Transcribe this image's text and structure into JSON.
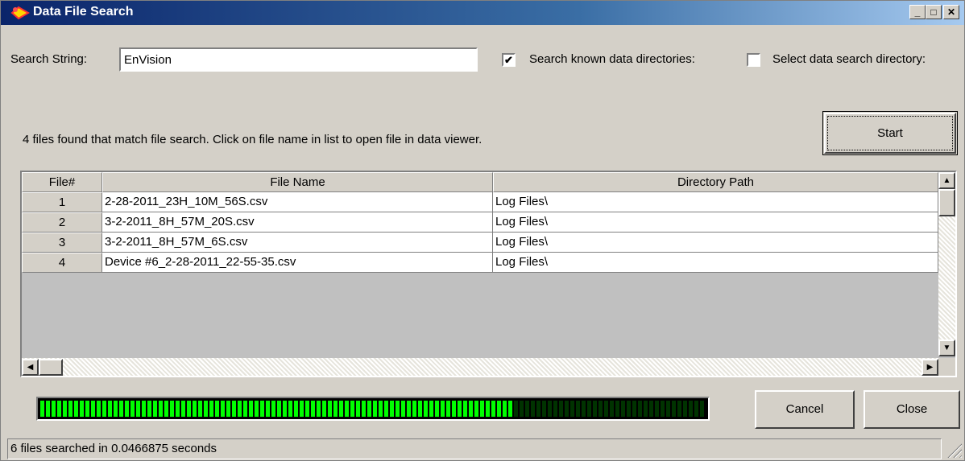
{
  "window": {
    "title": "Data File Search",
    "minimize": "_",
    "maximize": "□",
    "close": "✕"
  },
  "search": {
    "label": "Search String:",
    "value": "EnVision",
    "known_dirs_checked": true,
    "known_dirs_label": "Search known data directories:",
    "select_dir_checked": false,
    "select_dir_label": "Select data search directory:"
  },
  "result_message": "4 files found that match file search. Click on file name in list to open file in data viewer.",
  "buttons": {
    "start": "Start",
    "cancel": "Cancel",
    "close": "Close"
  },
  "table": {
    "columns": [
      "File#",
      "File Name",
      "Directory Path"
    ],
    "rows": [
      {
        "num": "1",
        "name": "2-28-2011_23H_10M_56S.csv",
        "path": "Log Files\\"
      },
      {
        "num": "2",
        "name": "3-2-2011_8H_57M_20S.csv",
        "path": "Log Files\\"
      },
      {
        "num": "3",
        "name": "3-2-2011_8H_57M_6S.csv",
        "path": "Log Files\\"
      },
      {
        "num": "4",
        "name": "Device #6_2-28-2011_22-55-35.csv",
        "path": "Log Files\\"
      }
    ]
  },
  "progress": {
    "fraction": 0.71,
    "fill_color": "#00ff00",
    "remaining_color": "#003300"
  },
  "status_text": "6 files searched in 0.0466875 seconds",
  "icons": {
    "app": "app-icon",
    "scroll_up": "▲",
    "scroll_down": "▼",
    "scroll_left": "◀",
    "scroll_right": "▶"
  }
}
